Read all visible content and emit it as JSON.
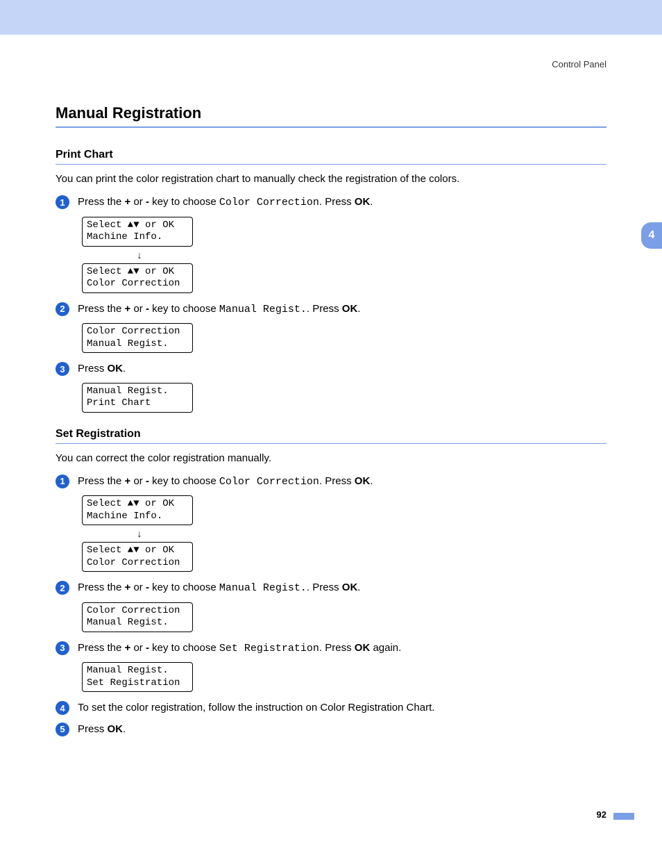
{
  "header": {
    "label": "Control Panel"
  },
  "sideTab": "4",
  "pageNumber": "92",
  "title": "Manual Registration",
  "sections": [
    {
      "title": "Print Chart",
      "desc": "You can print the color registration chart to manually check the registration of the colors.",
      "steps": [
        {
          "num": "1",
          "parts": [
            {
              "t": "Press the ",
              "c": ""
            },
            {
              "t": "+",
              "c": "bold"
            },
            {
              "t": " or ",
              "c": ""
            },
            {
              "t": "-",
              "c": "bold"
            },
            {
              "t": " key to choose ",
              "c": ""
            },
            {
              "t": "Color Correction",
              "c": "mono"
            },
            {
              "t": ". Press ",
              "c": ""
            },
            {
              "t": "OK",
              "c": "bold"
            },
            {
              "t": ".",
              "c": ""
            }
          ],
          "lcds": [
            {
              "line1": "Select ▲▼ or OK",
              "line2": "Machine Info."
            },
            {
              "arrow": true
            },
            {
              "line1": "Select ▲▼ or OK",
              "line2": "Color Correction"
            }
          ]
        },
        {
          "num": "2",
          "parts": [
            {
              "t": "Press the ",
              "c": ""
            },
            {
              "t": "+",
              "c": "bold"
            },
            {
              "t": " or ",
              "c": ""
            },
            {
              "t": "-",
              "c": "bold"
            },
            {
              "t": " key to choose ",
              "c": ""
            },
            {
              "t": "Manual Regist.",
              "c": "mono"
            },
            {
              "t": ". Press ",
              "c": ""
            },
            {
              "t": "OK",
              "c": "bold"
            },
            {
              "t": ".",
              "c": ""
            }
          ],
          "lcds": [
            {
              "line1": "Color Correction",
              "line2": "Manual Regist."
            }
          ]
        },
        {
          "num": "3",
          "parts": [
            {
              "t": "Press ",
              "c": ""
            },
            {
              "t": "OK",
              "c": "bold"
            },
            {
              "t": ".",
              "c": ""
            }
          ],
          "lcds": [
            {
              "line1": "Manual Regist.",
              "line2": "Print Chart"
            }
          ]
        }
      ]
    },
    {
      "title": "Set Registration",
      "desc": "You can correct the color registration manually.",
      "steps": [
        {
          "num": "1",
          "parts": [
            {
              "t": "Press the ",
              "c": ""
            },
            {
              "t": "+",
              "c": "bold"
            },
            {
              "t": " or ",
              "c": ""
            },
            {
              "t": "-",
              "c": "bold"
            },
            {
              "t": " key to choose ",
              "c": ""
            },
            {
              "t": "Color Correction",
              "c": "mono"
            },
            {
              "t": ". Press ",
              "c": ""
            },
            {
              "t": "OK",
              "c": "bold"
            },
            {
              "t": ".",
              "c": ""
            }
          ],
          "lcds": [
            {
              "line1": "Select ▲▼ or OK",
              "line2": "Machine Info."
            },
            {
              "arrow": true
            },
            {
              "line1": "Select ▲▼ or OK",
              "line2": "Color Correction"
            }
          ]
        },
        {
          "num": "2",
          "parts": [
            {
              "t": "Press the ",
              "c": ""
            },
            {
              "t": "+",
              "c": "bold"
            },
            {
              "t": " or ",
              "c": ""
            },
            {
              "t": "-",
              "c": "bold"
            },
            {
              "t": " key to choose ",
              "c": ""
            },
            {
              "t": "Manual Regist.",
              "c": "mono"
            },
            {
              "t": ". Press ",
              "c": ""
            },
            {
              "t": "OK",
              "c": "bold"
            },
            {
              "t": ".",
              "c": ""
            }
          ],
          "lcds": [
            {
              "line1": "Color Correction",
              "line2": "Manual Regist."
            }
          ]
        },
        {
          "num": "3",
          "parts": [
            {
              "t": "Press the ",
              "c": ""
            },
            {
              "t": "+",
              "c": "bold"
            },
            {
              "t": " or ",
              "c": ""
            },
            {
              "t": "-",
              "c": "bold"
            },
            {
              "t": " key to choose ",
              "c": ""
            },
            {
              "t": "Set Registration",
              "c": "mono"
            },
            {
              "t": ". Press ",
              "c": ""
            },
            {
              "t": "OK",
              "c": "bold"
            },
            {
              "t": " again.",
              "c": ""
            }
          ],
          "lcds": [
            {
              "line1": "Manual Regist.",
              "line2": "Set Registration"
            }
          ]
        },
        {
          "num": "4",
          "parts": [
            {
              "t": "To set the color registration, follow the instruction on Color Registration Chart.",
              "c": ""
            }
          ],
          "lcds": []
        },
        {
          "num": "5",
          "parts": [
            {
              "t": "Press ",
              "c": ""
            },
            {
              "t": "OK",
              "c": "bold"
            },
            {
              "t": ".",
              "c": ""
            }
          ],
          "lcds": []
        }
      ]
    }
  ]
}
